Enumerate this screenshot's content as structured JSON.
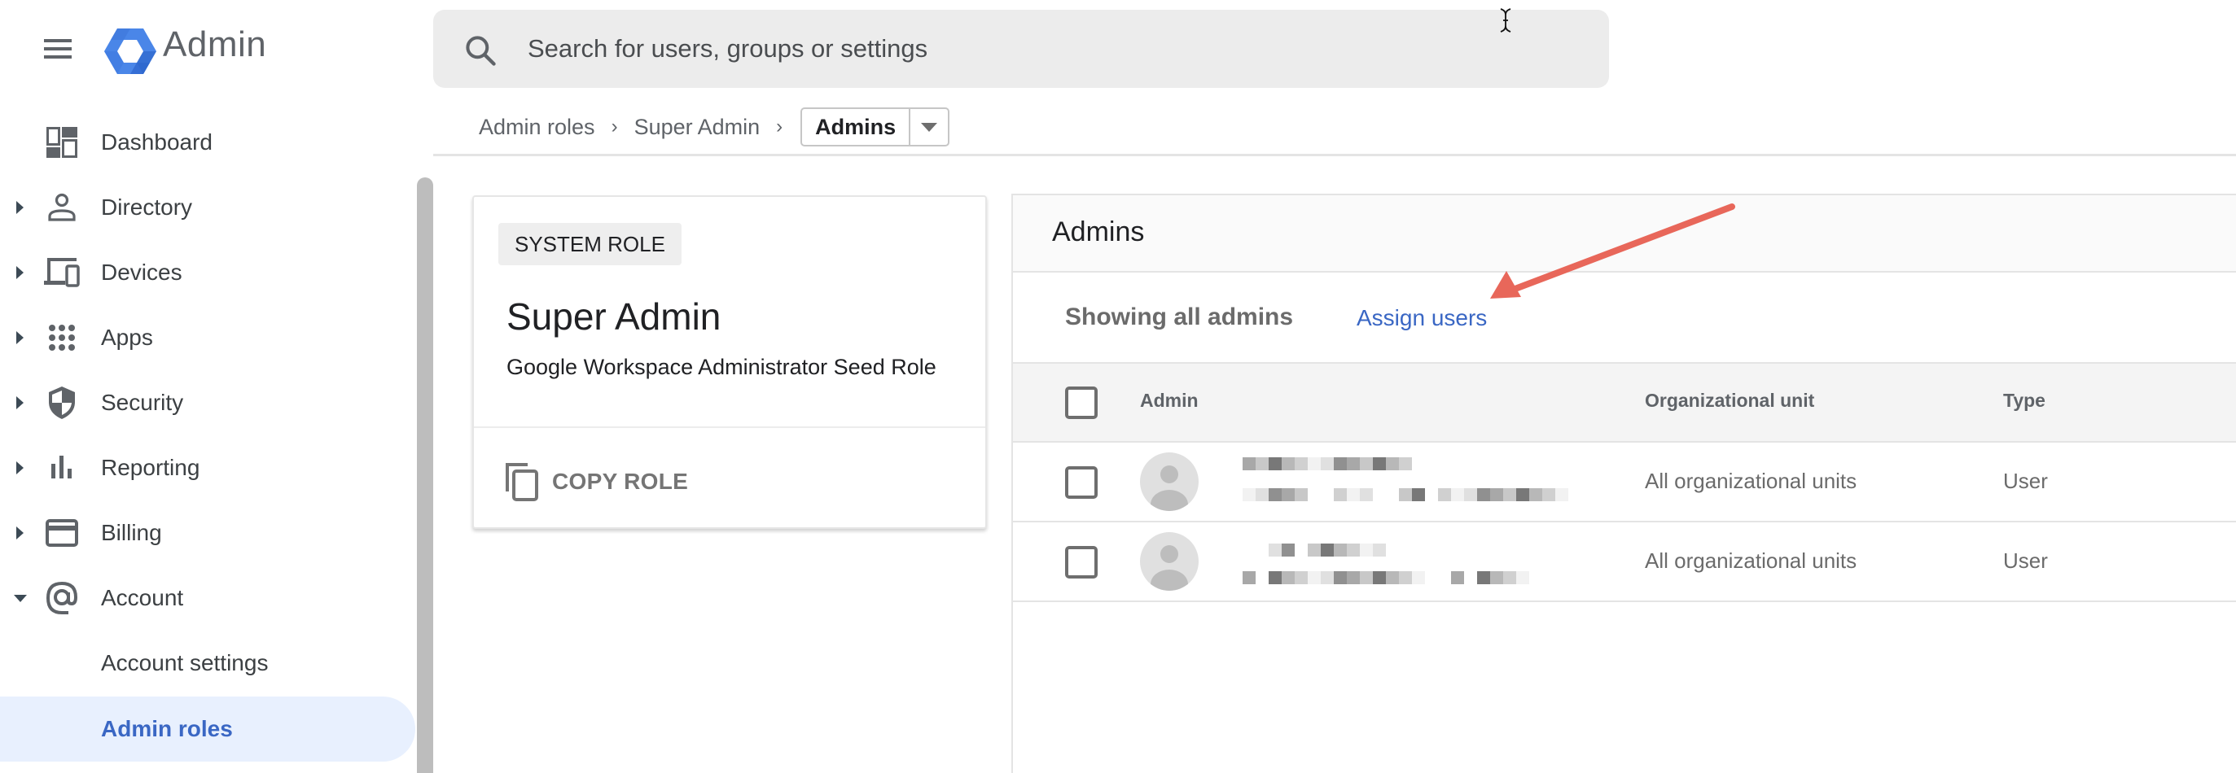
{
  "app": {
    "brand": "Admin",
    "menu_icon": "hamburger-menu-icon",
    "logo_icon": "admin-console-hexagon-logo"
  },
  "search": {
    "placeholder": "Search for users, groups or settings",
    "value": "",
    "icon": "search-icon"
  },
  "sidebar": {
    "items": [
      {
        "label": "Dashboard",
        "icon": "dashboard-icon",
        "expandable": false,
        "expanded": false
      },
      {
        "label": "Directory",
        "icon": "person-icon",
        "expandable": true,
        "expanded": false
      },
      {
        "label": "Devices",
        "icon": "devices-icon",
        "expandable": true,
        "expanded": false
      },
      {
        "label": "Apps",
        "icon": "apps-grid-icon",
        "expandable": true,
        "expanded": false
      },
      {
        "label": "Security",
        "icon": "shield-icon",
        "expandable": true,
        "expanded": false
      },
      {
        "label": "Reporting",
        "icon": "bar-chart-icon",
        "expandable": true,
        "expanded": false
      },
      {
        "label": "Billing",
        "icon": "credit-card-icon",
        "expandable": true,
        "expanded": false
      },
      {
        "label": "Account",
        "icon": "at-sign-icon",
        "expandable": true,
        "expanded": true
      }
    ],
    "subitems": [
      {
        "label": "Account settings",
        "active": false
      },
      {
        "label": "Admin roles",
        "active": true
      }
    ],
    "active_color": "#3a67c4",
    "active_bg": "#e8f0fe"
  },
  "breadcrumb": {
    "items": [
      "Admin roles",
      "Super Admin"
    ],
    "separator": "›",
    "current": "Admins"
  },
  "role_card": {
    "badge": "SYSTEM ROLE",
    "title": "Super Admin",
    "description": "Google Workspace Administrator Seed Role",
    "copy_label": "COPY ROLE",
    "copy_icon": "copy-icon"
  },
  "admins_panel": {
    "title": "Admins",
    "filter_text": "Showing all admins",
    "assign_link": "Assign users",
    "columns": [
      "Admin",
      "Organizational unit",
      "Type"
    ],
    "rows": [
      {
        "admin_name": "[redacted]",
        "admin_email": "[redacted]",
        "org_unit": "All organizational units",
        "type": "User",
        "checked": false
      },
      {
        "admin_name": "[redacted]",
        "admin_email": "[redacted]",
        "org_unit": "All organizational units",
        "type": "User",
        "checked": false
      }
    ]
  },
  "annotation": {
    "type": "arrow",
    "color": "#e8675a",
    "points_to": "Assign users"
  }
}
